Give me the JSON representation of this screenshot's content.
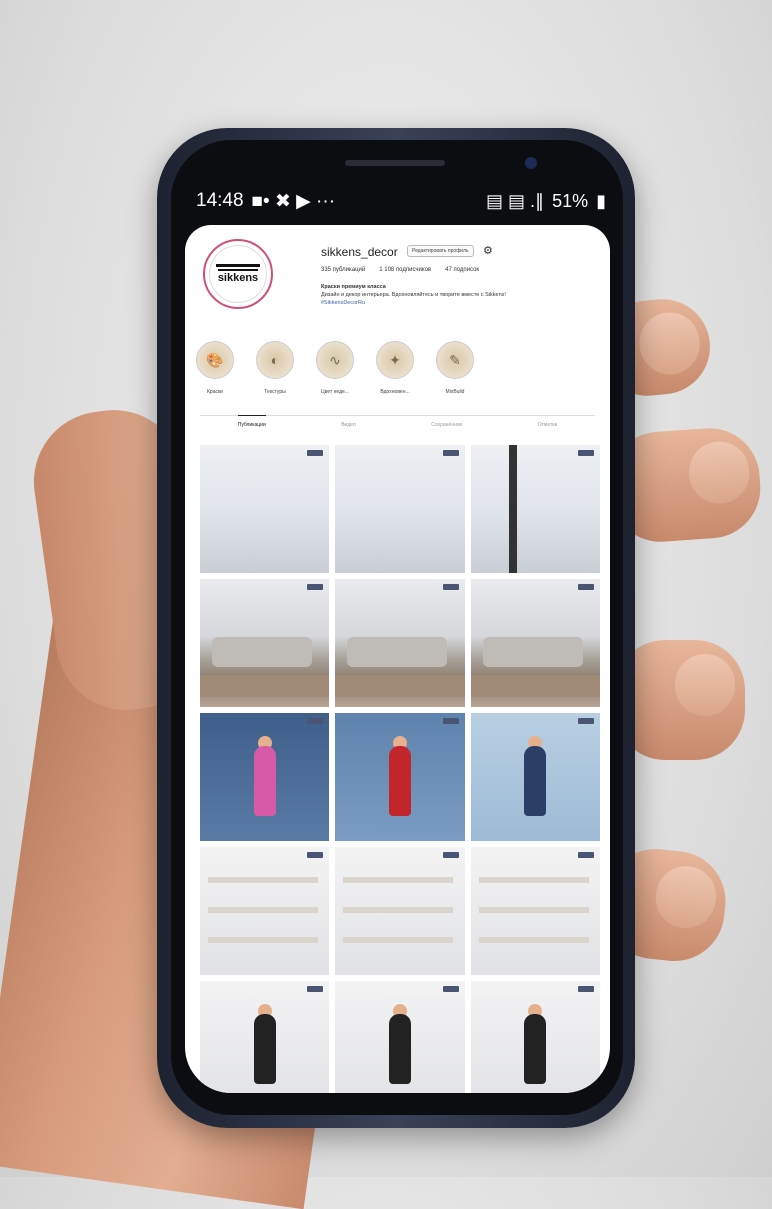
{
  "status_bar": {
    "time": "14:48",
    "left_icons": "■• ✖ ▶ ···",
    "right_icons": "▤ ▤ .∥",
    "battery": "51%"
  },
  "profile": {
    "username": "sikkens_decor",
    "edit_button": "Редактировать профиль",
    "avatar_brand": "sikkens",
    "stats": {
      "posts": "335 публикаций",
      "followers": "1 108 подписчиков",
      "following": "47 подписок"
    },
    "bio_name": "Краски премиум класса",
    "bio_text": "Дизайн и декор интерьера. Вдохновляйтесь и творите вместе с Sikkens!",
    "bio_link": "#SikkensDecorRu"
  },
  "highlights": [
    {
      "label": "Краски",
      "icon": "paint-palette-icon"
    },
    {
      "label": "Текстуры",
      "icon": "texture-icon"
    },
    {
      "label": "Цвет неде...",
      "icon": "signature-icon"
    },
    {
      "label": "Вдохновен...",
      "icon": "sparkle-icon"
    },
    {
      "label": "MixBuild",
      "icon": "brush-icon"
    }
  ],
  "tabs": [
    {
      "label": "Публикации",
      "active": true
    },
    {
      "label": "Видео",
      "active": false
    },
    {
      "label": "Сохранённое",
      "active": false
    },
    {
      "label": "Отметки",
      "active": false
    }
  ],
  "grid": [
    {
      "name": "post-empty-room-1",
      "style": "c-room"
    },
    {
      "name": "post-empty-room-2",
      "style": "c-room"
    },
    {
      "name": "post-empty-room-3",
      "style": "c-room"
    },
    {
      "name": "post-living-room-1",
      "style": "c-sofa"
    },
    {
      "name": "post-living-room-2",
      "style": "c-sofa"
    },
    {
      "name": "post-living-room-3",
      "style": "c-sofa"
    },
    {
      "name": "post-woman-blue-wall",
      "style": "c-blue"
    },
    {
      "name": "post-woman-red-jacket",
      "style": "c-blue2"
    },
    {
      "name": "post-woman-paint-chart",
      "style": "c-lb"
    },
    {
      "name": "post-studio-shelves-1",
      "style": "c-white"
    },
    {
      "name": "post-studio-shelves-2",
      "style": "c-white"
    },
    {
      "name": "post-studio-shelves-3",
      "style": "c-white"
    },
    {
      "name": "post-studio-team-1",
      "style": "c-white"
    },
    {
      "name": "post-studio-team-2",
      "style": "c-white"
    },
    {
      "name": "post-studio-team-3",
      "style": "c-white"
    }
  ],
  "colors": {
    "phone_frame": "#1d2230",
    "screen_bg": "#ffffff",
    "avatar_ring": "#d05070",
    "link": "#3a5fa8"
  }
}
